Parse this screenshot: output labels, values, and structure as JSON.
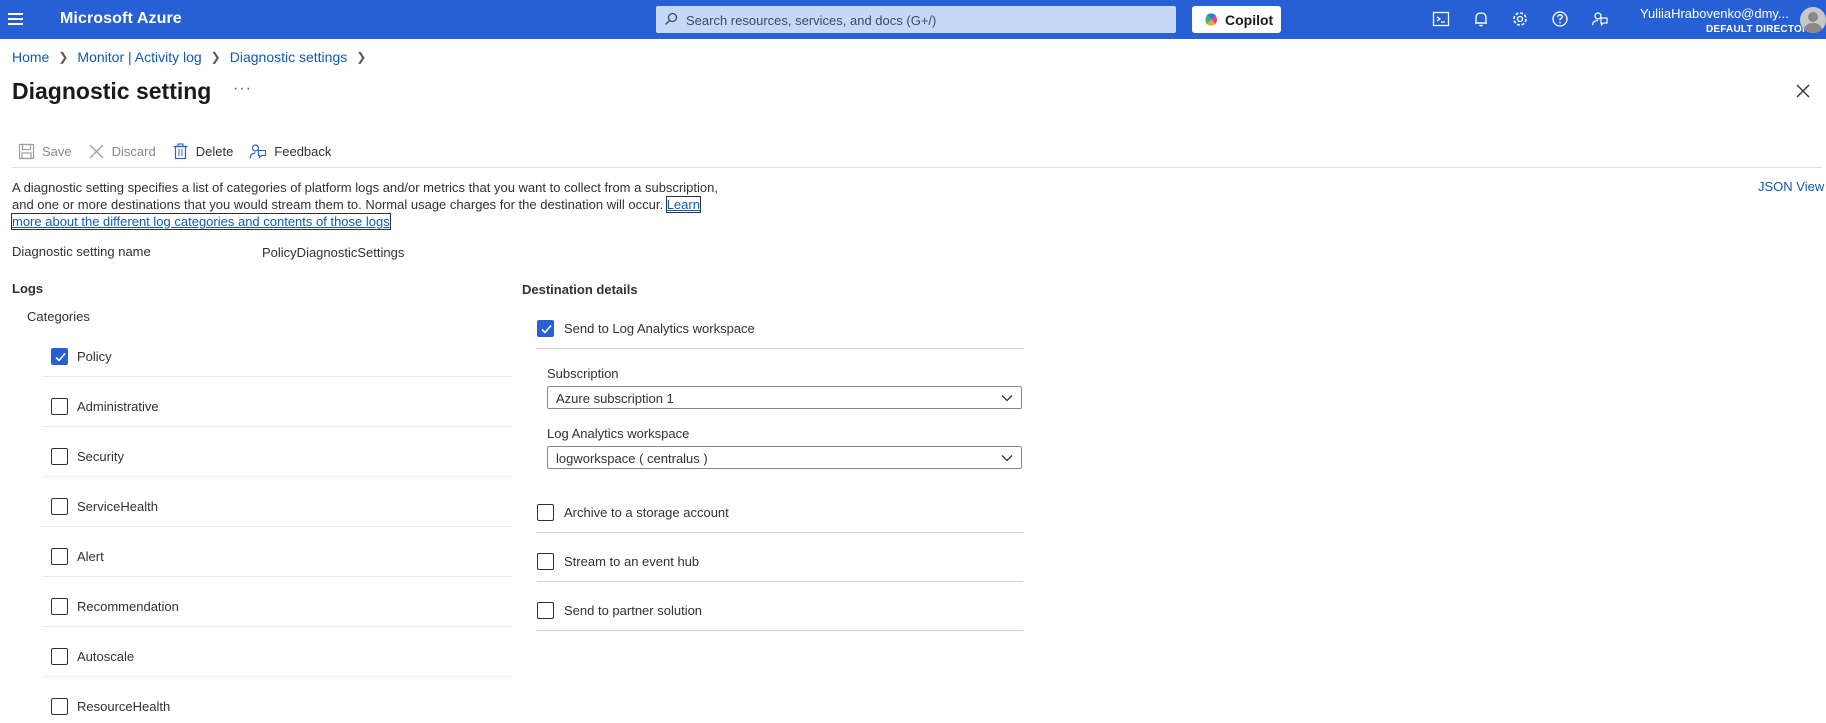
{
  "topbar": {
    "brand": "Microsoft Azure",
    "search_placeholder": "Search resources, services, and docs (G+/)",
    "copilot_label": "Copilot",
    "user_name": "YuliiaHrabovenko@dmy...",
    "user_directory": "DEFAULT DIRECTORY",
    "icons": [
      "cloud-shell-icon",
      "bell-icon",
      "gear-icon",
      "help-icon",
      "feedback-icon"
    ]
  },
  "breadcrumb": [
    "Home",
    "Monitor | Activity log",
    "Diagnostic settings"
  ],
  "page": {
    "title": "Diagnostic setting",
    "more": "···"
  },
  "toolbar": {
    "save": "Save",
    "discard": "Discard",
    "delete": "Delete",
    "feedback": "Feedback"
  },
  "description": {
    "text": "A diagnostic setting specifies a list of categories of platform logs and/or metrics that you want to collect from a subscription, and one or more destinations that you would stream them to. Normal usage charges for the destination will occur.",
    "link": "Learn more about the different log categories and contents of those logs"
  },
  "json_view": "JSON View",
  "setting": {
    "label": "Diagnostic setting name",
    "value": "PolicyDiagnosticSettings"
  },
  "logs": {
    "heading": "Logs",
    "categories_heading": "Categories",
    "categories": [
      {
        "label": "Policy",
        "checked": true
      },
      {
        "label": "Administrative",
        "checked": false
      },
      {
        "label": "Security",
        "checked": false
      },
      {
        "label": "ServiceHealth",
        "checked": false
      },
      {
        "label": "Alert",
        "checked": false
      },
      {
        "label": "Recommendation",
        "checked": false
      },
      {
        "label": "Autoscale",
        "checked": false
      },
      {
        "label": "ResourceHealth",
        "checked": false
      }
    ]
  },
  "destination": {
    "heading": "Destination details",
    "log_analytics": {
      "label": "Send to Log Analytics workspace",
      "checked": true
    },
    "subscription_label": "Subscription",
    "subscription_value": "Azure subscription 1",
    "workspace_label": "Log Analytics workspace",
    "workspace_value": "logworkspace ( centralus )",
    "storage": {
      "label": "Archive to a storage account",
      "checked": false
    },
    "event_hub": {
      "label": "Stream to an event hub",
      "checked": false
    },
    "partner": {
      "label": "Send to partner solution",
      "checked": false
    }
  },
  "colors": {
    "topbar": "#2660d4",
    "link": "#0f5ab8",
    "checkbox_checked": "#2660d4"
  }
}
